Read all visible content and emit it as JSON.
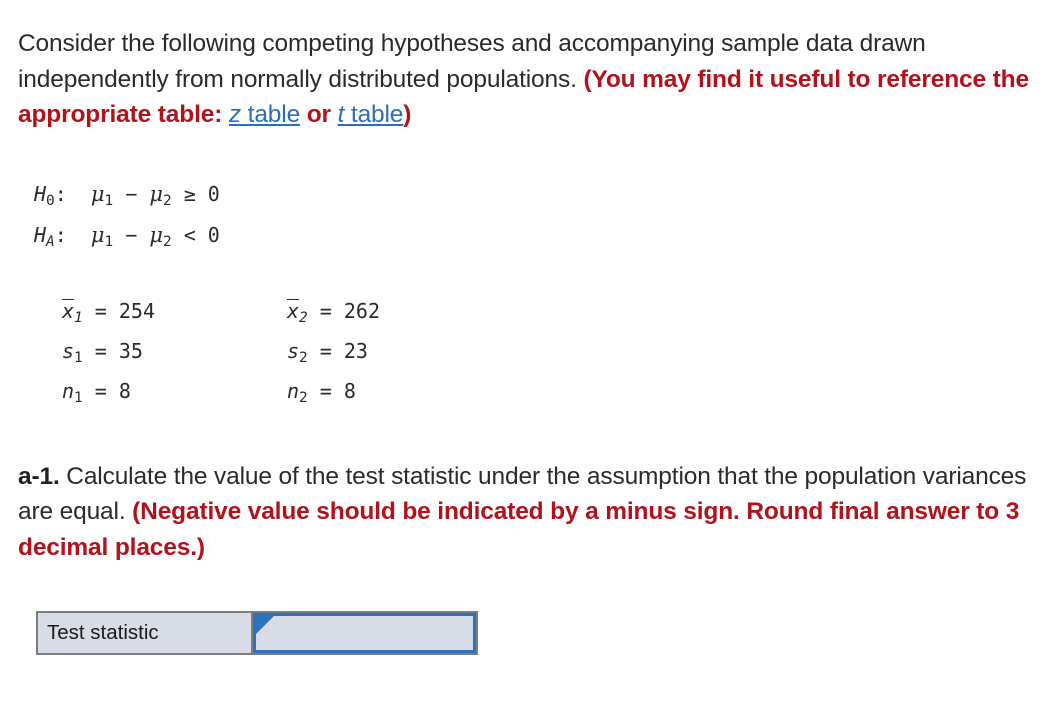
{
  "intro": {
    "line_1": "Consider the following competing hypotheses and accompanying sample data drawn independently from normally distributed populations.",
    "paren_open": "(You may find it useful to reference the appropriate table:",
    "link_z_var": "z",
    "link_z_word": " table",
    "conjunction": " or ",
    "link_t_var": "t",
    "link_t_word": " table",
    "paren_close": ")"
  },
  "hypotheses": {
    "null": {
      "symbol": "H",
      "subscript": "0",
      "colon": ":",
      "mu": "μ",
      "sub1": "1",
      "minus": "−",
      "sub2": "2",
      "operator": "≥",
      "value": "0",
      "full_text": "H0: μ1 − μ2 ≥ 0"
    },
    "alternative": {
      "symbol": "H",
      "subscript": "A",
      "colon": ":",
      "mu": "μ",
      "sub1": "1",
      "minus": "−",
      "sub2": "2",
      "operator": "<",
      "value": "0",
      "full_text": "HA: μ1 − μ2 < 0"
    }
  },
  "sample_data": {
    "sample_1": {
      "mean_symbol": "x",
      "mean_sub": "1",
      "mean_value": "254",
      "sd_symbol": "s",
      "sd_sub": "1",
      "sd_value": "35",
      "n_symbol": "n",
      "n_sub": "1",
      "n_value": "8"
    },
    "sample_2": {
      "mean_symbol": "x",
      "mean_sub": "2",
      "mean_value": "262",
      "sd_symbol": "s",
      "sd_sub": "2",
      "sd_value": "23",
      "n_symbol": "n",
      "n_sub": "2",
      "n_value": "8"
    },
    "equals": "="
  },
  "question": {
    "part_label": "a-1.",
    "prompt": " Calculate the value of the test statistic under the assumption that the population variances are equal. ",
    "instruction_red": "(Negative value should be indicated by a minus sign. Round final answer to 3 decimal places.)"
  },
  "answer": {
    "row_label": "Test statistic",
    "input_value": "",
    "input_placeholder": ""
  },
  "colors": {
    "red": "#b4121b",
    "link_blue": "#2a6ebb",
    "cell_fill": "#d7dce6",
    "cell_border_grey": "#7d7d7d",
    "input_border_blue": "#2c72bd",
    "text": "#2b2b2b"
  }
}
